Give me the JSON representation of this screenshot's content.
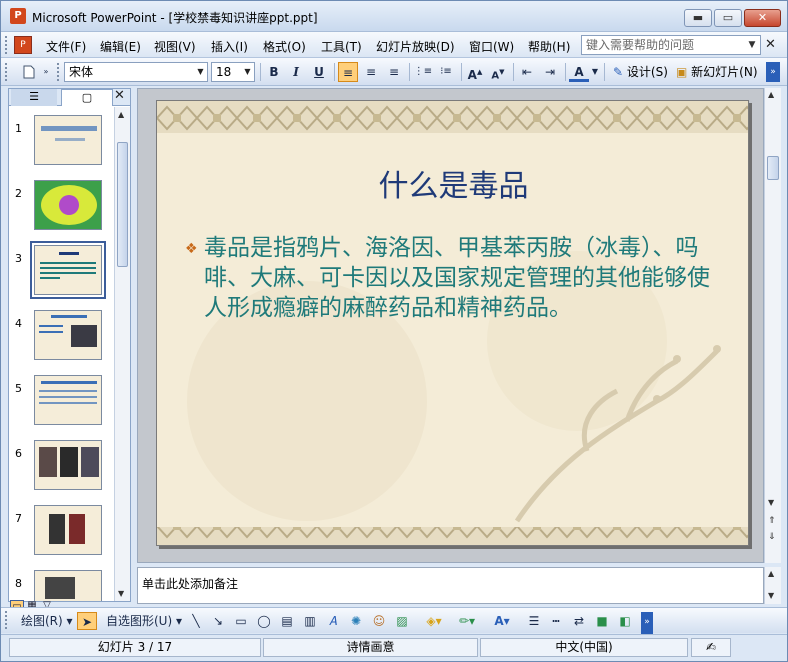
{
  "window": {
    "app_icon": "powerpoint-icon",
    "title": "Microsoft PowerPoint - [学校禁毒知识讲座ppt.ppt]",
    "btn_min": "▬",
    "btn_max": "▭",
    "btn_close": "✕"
  },
  "menubar": {
    "items": [
      "文件(F)",
      "编辑(E)",
      "视图(V)",
      "插入(I)",
      "格式(O)",
      "工具(T)",
      "幻灯片放映(D)",
      "窗口(W)",
      "帮助(H)"
    ],
    "help_placeholder": "键入需要帮助的问题",
    "doc_close": "✕"
  },
  "toolbar": {
    "font_name": "宋体",
    "font_size": "18",
    "bold": "B",
    "italic": "I",
    "underline": "U",
    "design_label": "设计(S)",
    "new_slide_label": "新幻灯片(N)"
  },
  "leftpanel": {
    "slide_numbers": [
      "1",
      "2",
      "3",
      "4",
      "5",
      "6",
      "7",
      "8"
    ],
    "selected_slide": 3,
    "close": "✕"
  },
  "slide": {
    "title": "什么是毒品",
    "bullet": "毒品是指鸦片、海洛因、甲基苯丙胺（冰毒）、吗啡、大麻、可卡因以及国家规定管理的其他能够使人形成瘾癖的麻醉药品和精神药品。",
    "accent_title": "#1f3a78",
    "accent_text": "#1f7a7a"
  },
  "notes": {
    "placeholder": "单击此处添加备注"
  },
  "drawbar": {
    "draw_label": "绘图(R)",
    "autoshapes_label": "自选图形(U)"
  },
  "statusbar": {
    "slide_info": "幻灯片 3 / 17",
    "design_name": "诗情画意",
    "language": "中文(中国)"
  }
}
